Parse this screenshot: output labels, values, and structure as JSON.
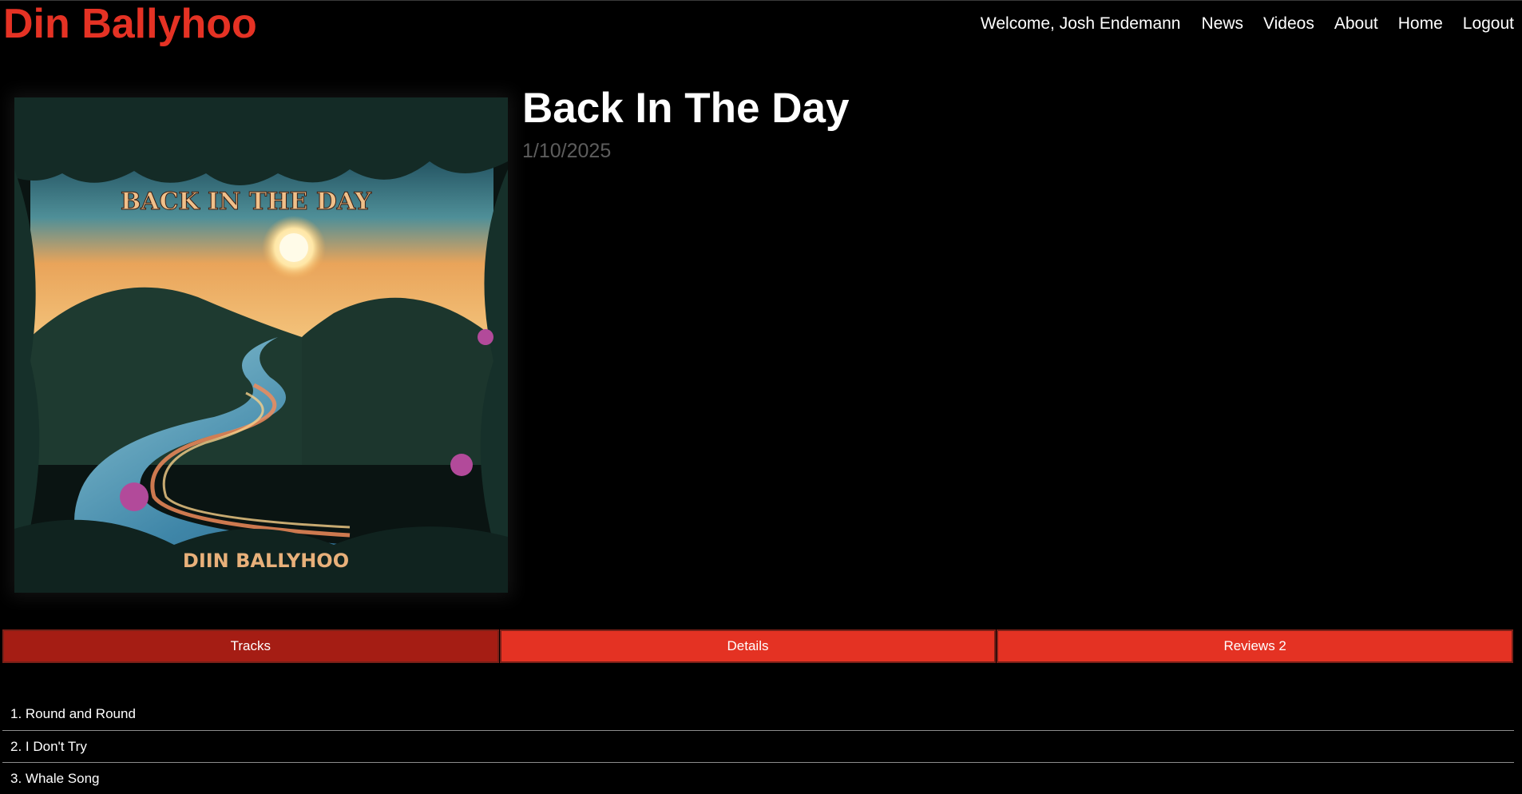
{
  "header": {
    "brand": "Din Ballyhoo",
    "welcome": "Welcome, Josh Endemann",
    "nav": [
      "News",
      "Videos",
      "About",
      "Home",
      "Logout"
    ]
  },
  "album": {
    "title": "Back In The Day",
    "date": "1/10/2025",
    "cover_text_top": "BACK IN THE DAY",
    "cover_text_bottom": "DIIN BALLYHOO"
  },
  "tabs": [
    {
      "label": "Tracks",
      "active": true
    },
    {
      "label": "Details",
      "active": false
    },
    {
      "label": "Reviews 2",
      "active": false
    }
  ],
  "tracks": [
    "1. Round and Round",
    "2. I Don't Try",
    "3. Whale Song"
  ],
  "colors": {
    "brand_red": "#e53224",
    "tab_red": "#e43223",
    "tab_active": "#a51d14",
    "background": "#000000"
  }
}
